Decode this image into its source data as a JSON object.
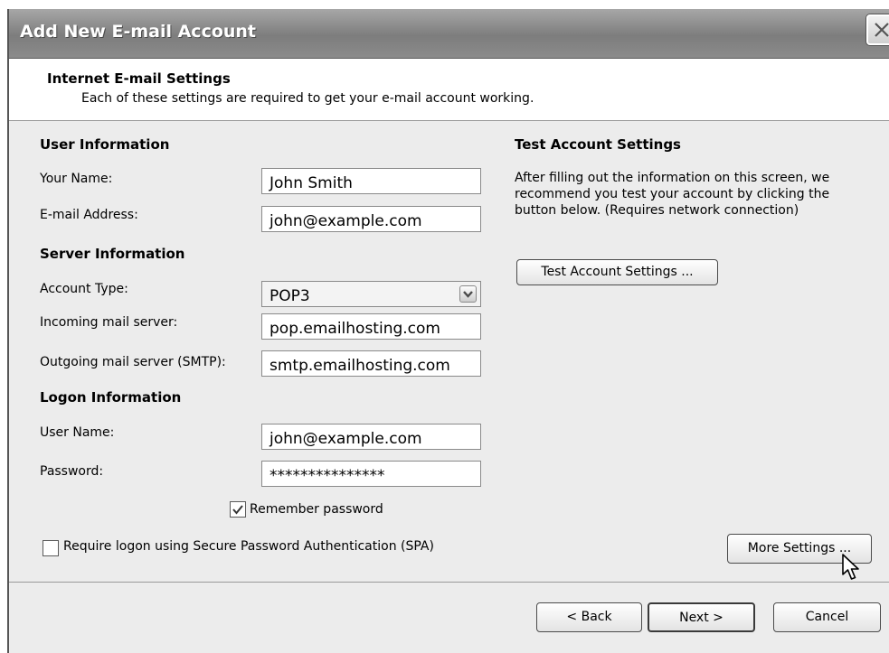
{
  "window": {
    "title": "Add New E-mail Account"
  },
  "header": {
    "title": "Internet E-mail Settings",
    "subtitle": "Each of these settings are required to get your e-mail account working."
  },
  "user_info": {
    "heading": "User Information",
    "name_label": "Your Name:",
    "name_value": "John Smith",
    "email_label": "E-mail Address:",
    "email_value": "john@example.com"
  },
  "server_info": {
    "heading": "Server Information",
    "account_type_label": "Account Type:",
    "account_type_value": "POP3",
    "incoming_label": "Incoming mail server:",
    "incoming_value": "pop.emailhosting.com",
    "outgoing_label": "Outgoing mail server (SMTP):",
    "outgoing_value": "smtp.emailhosting.com"
  },
  "logon_info": {
    "heading": "Logon Information",
    "username_label": "User Name:",
    "username_value": "john@example.com",
    "password_label": "Password:",
    "password_value": "***************",
    "remember_label": "Remember password",
    "remember_checked": true,
    "spa_label": "Require logon using Secure Password Authentication (SPA)",
    "spa_checked": false
  },
  "test": {
    "heading": "Test Account Settings",
    "line1": "After filling out the information on this screen, we",
    "line2": "recommend you test your account by clicking the",
    "line3": "button below. (Requires network connection)",
    "button_label": "Test Account Settings ..."
  },
  "more_settings_label": "More Settings ...",
  "footer": {
    "back_label": "< Back",
    "next_label": "Next >",
    "cancel_label": "Cancel"
  },
  "icons": {
    "close": "close-icon",
    "dropdown": "chevron-down-icon",
    "check": "checkmark-icon",
    "cursor": "mouse-pointer-icon"
  },
  "colors": {
    "titlebar": "#8b8b8b",
    "panel": "#ececec",
    "field_bg": "#ffffff"
  }
}
